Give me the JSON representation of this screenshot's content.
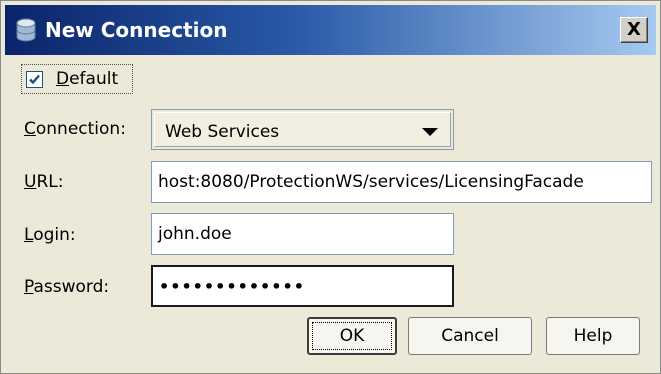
{
  "window": {
    "title": "New Connection",
    "close_label": "X"
  },
  "form": {
    "default_checkbox": {
      "label_prefix": "",
      "label_mnemonic": "D",
      "label_rest": "efault",
      "checked": true
    },
    "connection": {
      "label_mnemonic": "C",
      "label_rest": "onnection:",
      "selected_value": "Web Services"
    },
    "url": {
      "label_mnemonic": "U",
      "label_rest": "RL:",
      "value": "host:8080/ProtectionWS/services/LicensingFacade"
    },
    "login": {
      "label_mnemonic": "L",
      "label_rest": "ogin:",
      "value": "john.doe"
    },
    "password": {
      "label_mnemonic": "P",
      "label_rest": "assword:",
      "masked_value": "•••••••••••••"
    }
  },
  "buttons": {
    "ok": "OK",
    "cancel": "Cancel",
    "help": "Help"
  },
  "colors": {
    "title_gradient_start": "#0a246a",
    "title_gradient_end": "#a6caf0",
    "dialog_background": "#ece9d8",
    "checkbox_check": "#1c5180"
  }
}
